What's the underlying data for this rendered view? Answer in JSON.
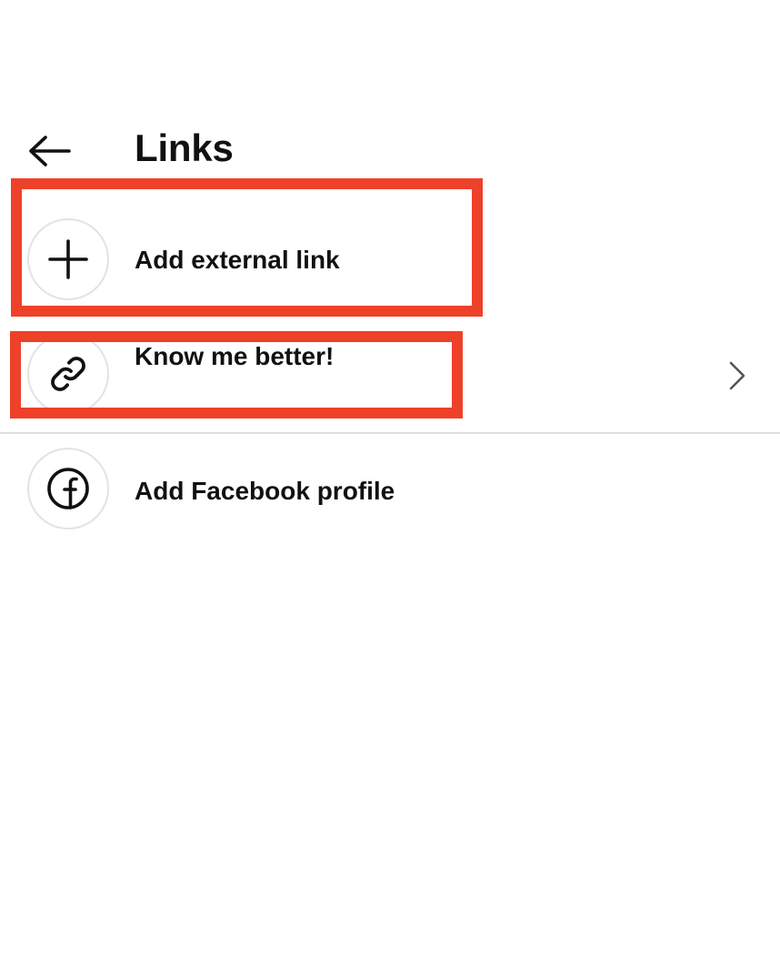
{
  "header": {
    "title": "Links",
    "back_icon": "arrow-left-icon"
  },
  "links": [
    {
      "label": "Add external link",
      "icon": "plus-icon"
    },
    {
      "label": "Know me better!",
      "icon": "link-icon",
      "trailing_icon": "chevron-right-icon"
    },
    {
      "label": "Add Facebook profile",
      "icon": "facebook-icon"
    }
  ],
  "annotation": {
    "highlight_color": "#ee4129"
  }
}
